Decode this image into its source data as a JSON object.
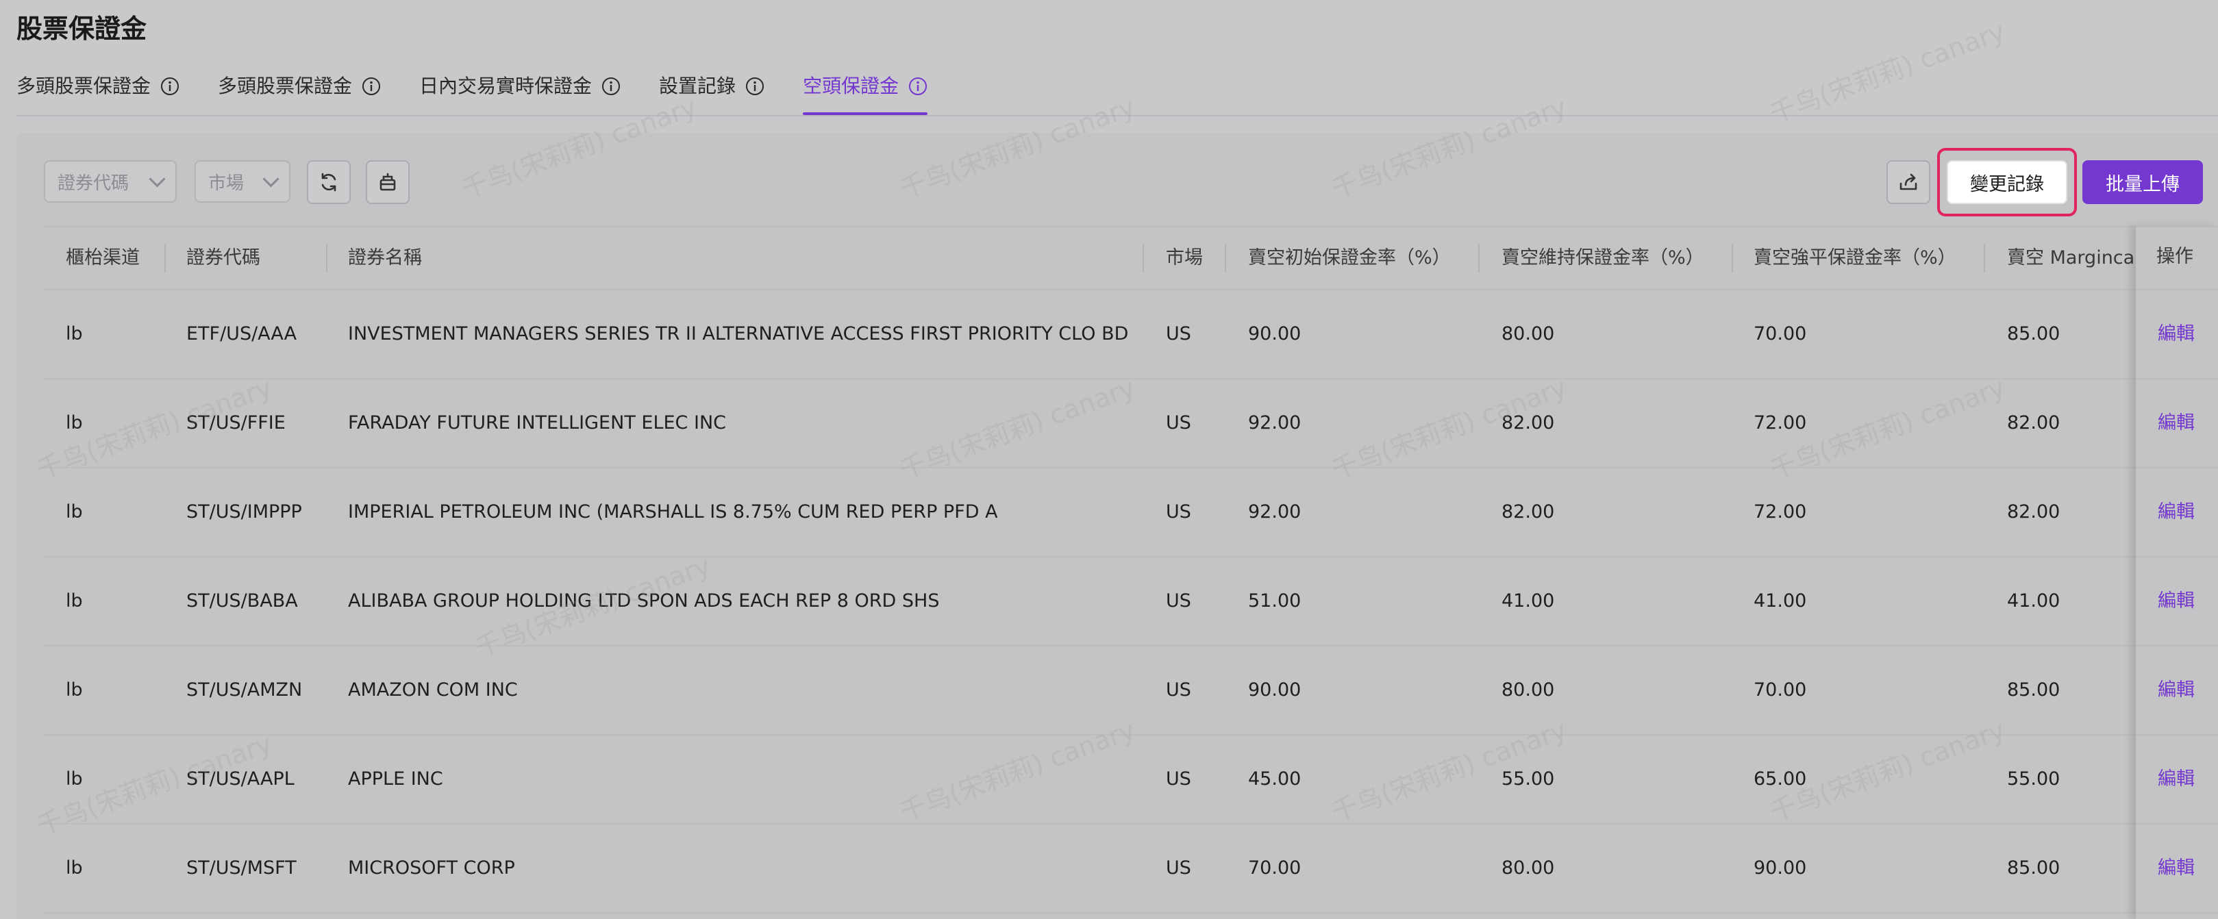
{
  "page": {
    "title": "股票保證金"
  },
  "tabs": [
    {
      "label": "多頭股票保證金"
    },
    {
      "label": "多頭股票保證金"
    },
    {
      "label": "日內交易實時保證金"
    },
    {
      "label": "設置記錄"
    },
    {
      "label": "空頭保證金",
      "active": true
    }
  ],
  "toolbar": {
    "security_code_placeholder": "證券代碼",
    "market_placeholder": "市場",
    "change_record_label": "變更記錄",
    "batch_upload_label": "批量上傳"
  },
  "table": {
    "columns": [
      "櫃枱渠道",
      "證券代碼",
      "證券名稱",
      "市場",
      "賣空初始保證金率（%）",
      "賣空維持保證金率（%）",
      "賣空強平保證金率（%）",
      "賣空 Margincall",
      "操作"
    ],
    "rows": [
      {
        "channel": "lb",
        "code": "ETF/US/AAA",
        "name": "INVESTMENT MANAGERS SERIES TR II ALTERNATIVE ACCESS FIRST PRIORITY CLO BD",
        "market": "US",
        "initial": "90.00",
        "maintenance": "80.00",
        "liquidation": "70.00",
        "margincall": "85.00",
        "action": "編輯"
      },
      {
        "channel": "lb",
        "code": "ST/US/FFIE",
        "name": "FARADAY FUTURE INTELLIGENT ELEC INC",
        "market": "US",
        "initial": "92.00",
        "maintenance": "82.00",
        "liquidation": "72.00",
        "margincall": "82.00",
        "action": "編輯"
      },
      {
        "channel": "lb",
        "code": "ST/US/IMPPP",
        "name": "IMPERIAL PETROLEUM INC (MARSHALL IS 8.75% CUM RED PERP PFD A",
        "market": "US",
        "initial": "92.00",
        "maintenance": "82.00",
        "liquidation": "72.00",
        "margincall": "82.00",
        "action": "編輯"
      },
      {
        "channel": "lb",
        "code": "ST/US/BABA",
        "name": "ALIBABA GROUP HOLDING LTD SPON ADS EACH REP 8 ORD SHS",
        "market": "US",
        "initial": "51.00",
        "maintenance": "41.00",
        "liquidation": "41.00",
        "margincall": "41.00",
        "action": "編輯"
      },
      {
        "channel": "lb",
        "code": "ST/US/AMZN",
        "name": "AMAZON COM INC",
        "market": "US",
        "initial": "90.00",
        "maintenance": "80.00",
        "liquidation": "70.00",
        "margincall": "85.00",
        "action": "編輯"
      },
      {
        "channel": "lb",
        "code": "ST/US/AAPL",
        "name": "APPLE INC",
        "market": "US",
        "initial": "45.00",
        "maintenance": "55.00",
        "liquidation": "65.00",
        "margincall": "55.00",
        "action": "編輯"
      },
      {
        "channel": "lb",
        "code": "ST/US/MSFT",
        "name": "MICROSOFT CORP",
        "market": "US",
        "initial": "70.00",
        "maintenance": "80.00",
        "liquidation": "90.00",
        "margincall": "85.00",
        "action": "編輯"
      }
    ]
  },
  "watermark": {
    "text": "千鸟(宋莉莉) canary"
  },
  "colors": {
    "accent": "#7437cf",
    "highlight": "#e0245e"
  },
  "icons": [
    "info-icon",
    "chevron-down-icon",
    "refresh-icon",
    "clear-icon",
    "export-icon"
  ]
}
